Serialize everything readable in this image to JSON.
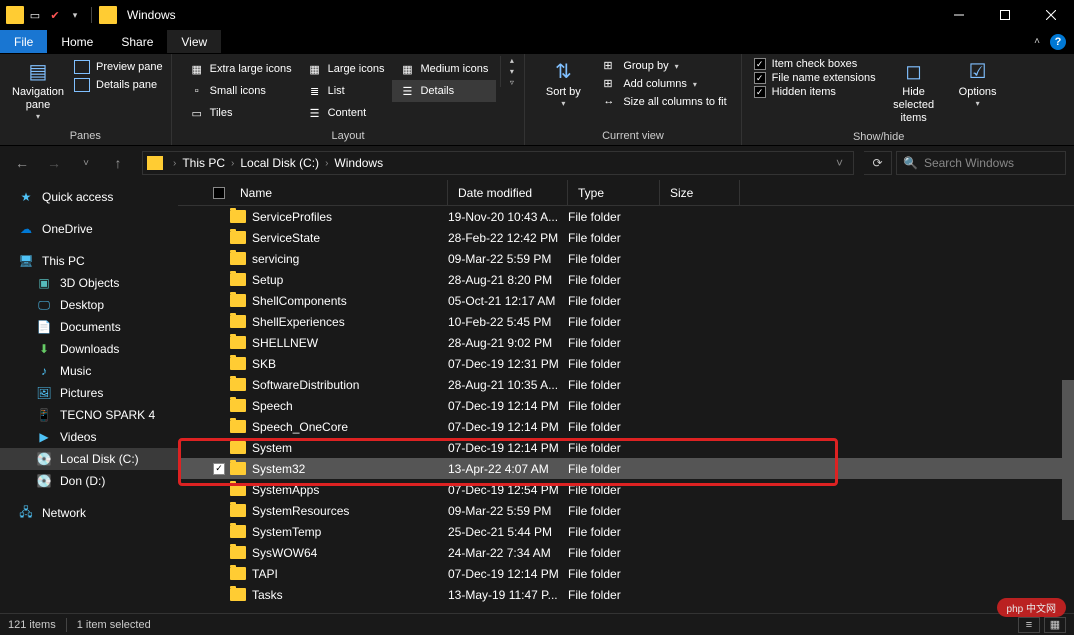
{
  "window": {
    "title": "Windows"
  },
  "menubar": {
    "file": "File",
    "home": "Home",
    "share": "Share",
    "view": "View"
  },
  "ribbon": {
    "panes": {
      "navigation_pane": "Navigation pane",
      "preview_pane": "Preview pane",
      "details_pane": "Details pane",
      "group": "Panes"
    },
    "layout": {
      "extra_large": "Extra large icons",
      "large": "Large icons",
      "medium": "Medium icons",
      "small": "Small icons",
      "list": "List",
      "details": "Details",
      "tiles": "Tiles",
      "content": "Content",
      "group": "Layout"
    },
    "current_view": {
      "sort_by": "Sort by",
      "group_by": "Group by",
      "add_columns": "Add columns",
      "size_all": "Size all columns to fit",
      "group": "Current view"
    },
    "show_hide": {
      "item_check": "Item check boxes",
      "file_ext": "File name extensions",
      "hidden_items": "Hidden items",
      "hide_selected": "Hide selected items",
      "options": "Options",
      "group": "Show/hide",
      "checks": {
        "item_check": true,
        "file_ext": true,
        "hidden_items": true
      }
    }
  },
  "breadcrumbs": [
    "This PC",
    "Local Disk (C:)",
    "Windows"
  ],
  "search": {
    "placeholder": "Search Windows"
  },
  "navtree": {
    "quick_access": "Quick access",
    "onedrive": "OneDrive",
    "this_pc": "This PC",
    "children": [
      "3D Objects",
      "Desktop",
      "Documents",
      "Downloads",
      "Music",
      "Pictures",
      "TECNO SPARK 4",
      "Videos",
      "Local Disk (C:)",
      "Don (D:)"
    ],
    "network": "Network"
  },
  "columns": {
    "name": "Name",
    "date": "Date modified",
    "type": "Type",
    "size": "Size"
  },
  "files": [
    {
      "name": "ServiceProfiles",
      "date": "19-Nov-20 10:43 A...",
      "type": "File folder"
    },
    {
      "name": "ServiceState",
      "date": "28-Feb-22 12:42 PM",
      "type": "File folder"
    },
    {
      "name": "servicing",
      "date": "09-Mar-22 5:59 PM",
      "type": "File folder"
    },
    {
      "name": "Setup",
      "date": "28-Aug-21 8:20 PM",
      "type": "File folder"
    },
    {
      "name": "ShellComponents",
      "date": "05-Oct-21 12:17 AM",
      "type": "File folder"
    },
    {
      "name": "ShellExperiences",
      "date": "10-Feb-22 5:45 PM",
      "type": "File folder"
    },
    {
      "name": "SHELLNEW",
      "date": "28-Aug-21 9:02 PM",
      "type": "File folder"
    },
    {
      "name": "SKB",
      "date": "07-Dec-19 12:31 PM",
      "type": "File folder"
    },
    {
      "name": "SoftwareDistribution",
      "date": "28-Aug-21 10:35 A...",
      "type": "File folder"
    },
    {
      "name": "Speech",
      "date": "07-Dec-19 12:14 PM",
      "type": "File folder"
    },
    {
      "name": "Speech_OneCore",
      "date": "07-Dec-19 12:14 PM",
      "type": "File folder"
    },
    {
      "name": "System",
      "date": "07-Dec-19 12:14 PM",
      "type": "File folder"
    },
    {
      "name": "System32",
      "date": "13-Apr-22 4:07 AM",
      "type": "File folder",
      "selected": true
    },
    {
      "name": "SystemApps",
      "date": "07-Dec-19 12:54 PM",
      "type": "File folder"
    },
    {
      "name": "SystemResources",
      "date": "09-Mar-22 5:59 PM",
      "type": "File folder"
    },
    {
      "name": "SystemTemp",
      "date": "25-Dec-21 5:44 PM",
      "type": "File folder"
    },
    {
      "name": "SysWOW64",
      "date": "24-Mar-22 7:34 AM",
      "type": "File folder"
    },
    {
      "name": "TAPI",
      "date": "07-Dec-19 12:14 PM",
      "type": "File folder"
    },
    {
      "name": "Tasks",
      "date": "13-May-19 11:47 P...",
      "type": "File folder"
    }
  ],
  "status": {
    "count": "121 items",
    "selected": "1 item selected"
  },
  "watermark": "php 中文网"
}
